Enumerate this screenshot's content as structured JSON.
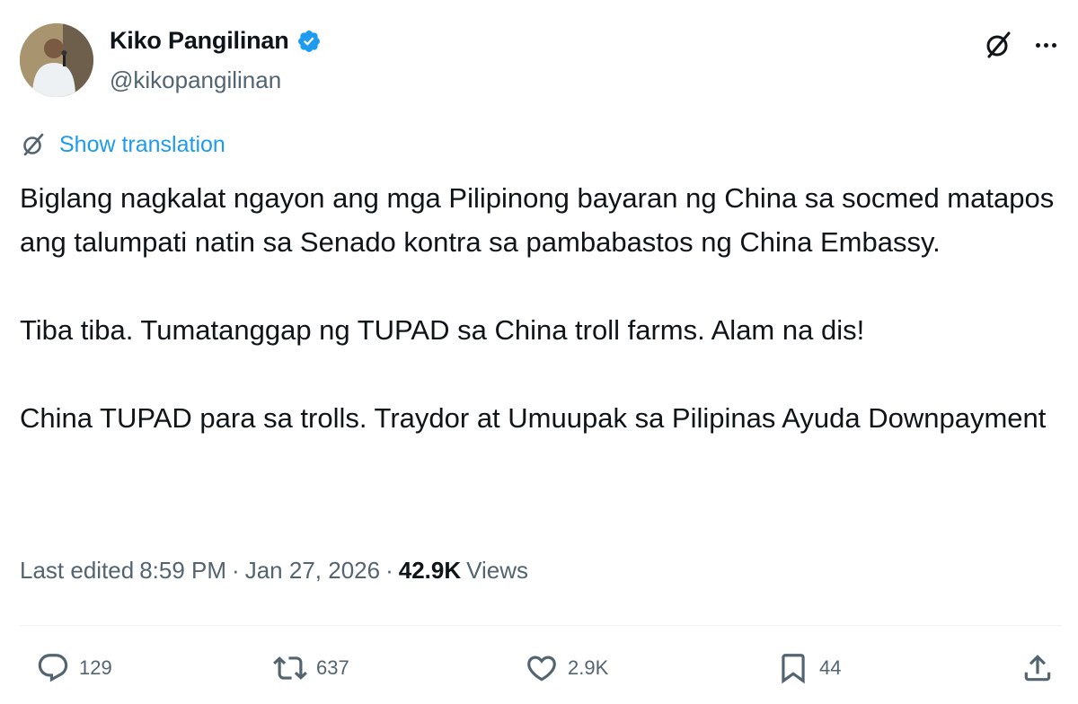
{
  "author": {
    "display_name": "Kiko Pangilinan",
    "handle": "@kikopangilinan",
    "verified": true,
    "verified_color": "#1d9bf0"
  },
  "header_icons": {
    "grok": "grok-icon",
    "more": "more-options-icon"
  },
  "translation": {
    "label": "Show translation",
    "icon": "translate-icon",
    "color": "#1d9bf0"
  },
  "tweet": {
    "paragraphs": [
      "Biglang nagkalat ngayon ang mga Pilipinong bayaran ng China sa socmed matapos ang talumpati natin sa Senado kontra sa pambabastos ng China Embassy.",
      "Tiba tiba. Tumatanggap ng TUPAD sa China troll farms. Alam na dis!",
      "China TUPAD para sa trolls. Traydor at Umuupak sa Pilipinas Ayuda Downpayment"
    ]
  },
  "meta": {
    "edited_prefix": "Last edited",
    "time": "8:59 PM",
    "date": "Jan 27, 2026",
    "views_count": "42.9K",
    "views_label": "Views"
  },
  "actions": {
    "replies": "129",
    "reposts": "637",
    "likes": "2.9K",
    "bookmarks": "44"
  },
  "colors": {
    "text": "#0f1419",
    "secondary": "#536471",
    "accent": "#1d9bf0",
    "divider": "#eff3f4"
  }
}
